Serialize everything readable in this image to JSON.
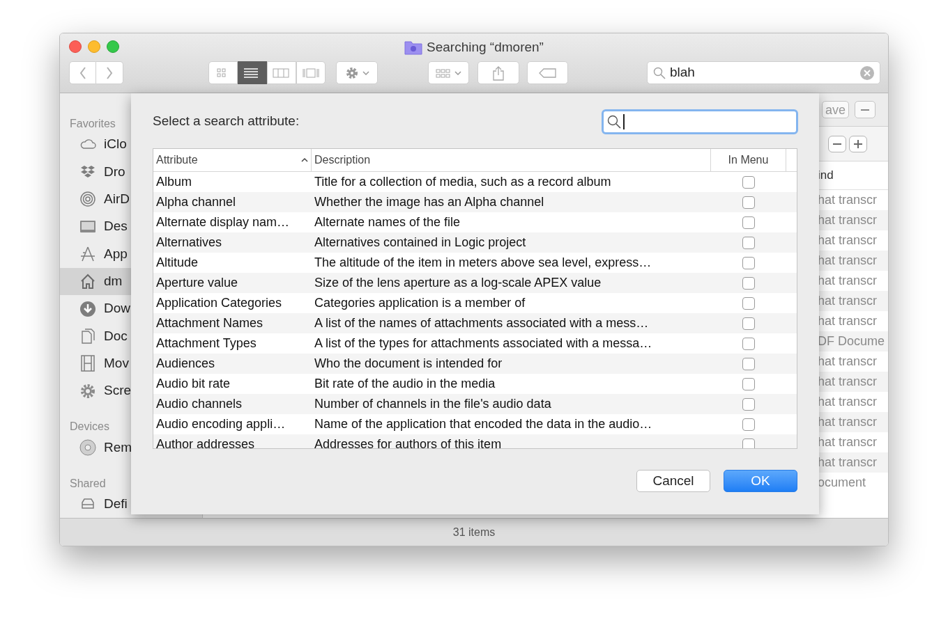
{
  "window": {
    "title": "Searching “dmoren”"
  },
  "toolbar": {
    "view_modes": [
      {
        "kind": "icons",
        "selected": false
      },
      {
        "kind": "list",
        "selected": true
      },
      {
        "kind": "columns",
        "selected": false
      },
      {
        "kind": "coverflow",
        "selected": false
      }
    ],
    "search": {
      "value": "blah"
    }
  },
  "sidebar": {
    "sections": [
      {
        "heading": "Favorites",
        "items": [
          {
            "label": "iClo",
            "selected": false
          },
          {
            "label": "Dro",
            "selected": false
          },
          {
            "label": "AirD",
            "selected": false
          },
          {
            "label": "Des",
            "selected": false
          },
          {
            "label": "App",
            "selected": false
          },
          {
            "label": "dm",
            "selected": true
          },
          {
            "label": "Dow",
            "selected": false
          },
          {
            "label": "Doc",
            "selected": false
          },
          {
            "label": "Mov",
            "selected": false
          },
          {
            "label": "Scre",
            "selected": false
          }
        ]
      },
      {
        "heading": "Devices",
        "items": [
          {
            "label": "Rem",
            "selected": false
          }
        ]
      },
      {
        "heading": "Shared",
        "items": [
          {
            "label": "Defi",
            "selected": false
          }
        ]
      }
    ]
  },
  "results": {
    "save_button": "ave",
    "column_heading": "ind",
    "rows": [
      "hat transcr",
      "hat transcr",
      "hat transcr",
      "hat transcr",
      "hat transcr",
      "hat transcr",
      "hat transcr",
      "DF Docume",
      "hat transcr",
      "hat transcr",
      "hat transcr",
      "hat transcr",
      "hat transcr",
      "hat transcr",
      "ocument"
    ]
  },
  "dialog": {
    "prompt": "Select a search attribute:",
    "columns": [
      {
        "label": "Attribute",
        "sorted": true
      },
      {
        "label": "Description",
        "sorted": false
      },
      {
        "label": "In Menu",
        "sorted": false
      }
    ],
    "rows": [
      {
        "attribute": "Album",
        "description": "Title for a collection of media, such as a record album",
        "in_menu": false
      },
      {
        "attribute": "Alpha channel",
        "description": "Whether the image has an Alpha channel",
        "in_menu": false
      },
      {
        "attribute": "Alternate display nam…",
        "description": "Alternate names of the file",
        "in_menu": false
      },
      {
        "attribute": "Alternatives",
        "description": "Alternatives contained in Logic project",
        "in_menu": false
      },
      {
        "attribute": "Altitude",
        "description": "The altitude of the item in meters above sea level, express…",
        "in_menu": false
      },
      {
        "attribute": "Aperture value",
        "description": "Size of the lens aperture as a log-scale APEX value",
        "in_menu": false
      },
      {
        "attribute": "Application Categories",
        "description": "Categories application is a member of",
        "in_menu": false
      },
      {
        "attribute": "Attachment Names",
        "description": "A list of the names of attachments associated with a mess…",
        "in_menu": false
      },
      {
        "attribute": "Attachment Types",
        "description": "A list of the types for attachments associated with a messa…",
        "in_menu": false
      },
      {
        "attribute": "Audiences",
        "description": "Who the document is intended for",
        "in_menu": false
      },
      {
        "attribute": "Audio bit rate",
        "description": "Bit rate of the audio in the media",
        "in_menu": false
      },
      {
        "attribute": "Audio channels",
        "description": "Number of channels in the file's audio data",
        "in_menu": false
      },
      {
        "attribute": "Audio encoding appli…",
        "description": "Name of the application that encoded the data in the audio…",
        "in_menu": false
      },
      {
        "attribute": "Author addresses",
        "description": "Addresses for authors of this item",
        "in_menu": false
      }
    ],
    "buttons": [
      {
        "label": "Cancel",
        "default": false
      },
      {
        "label": "OK",
        "default": true
      }
    ]
  },
  "status_bar": "31 items"
}
